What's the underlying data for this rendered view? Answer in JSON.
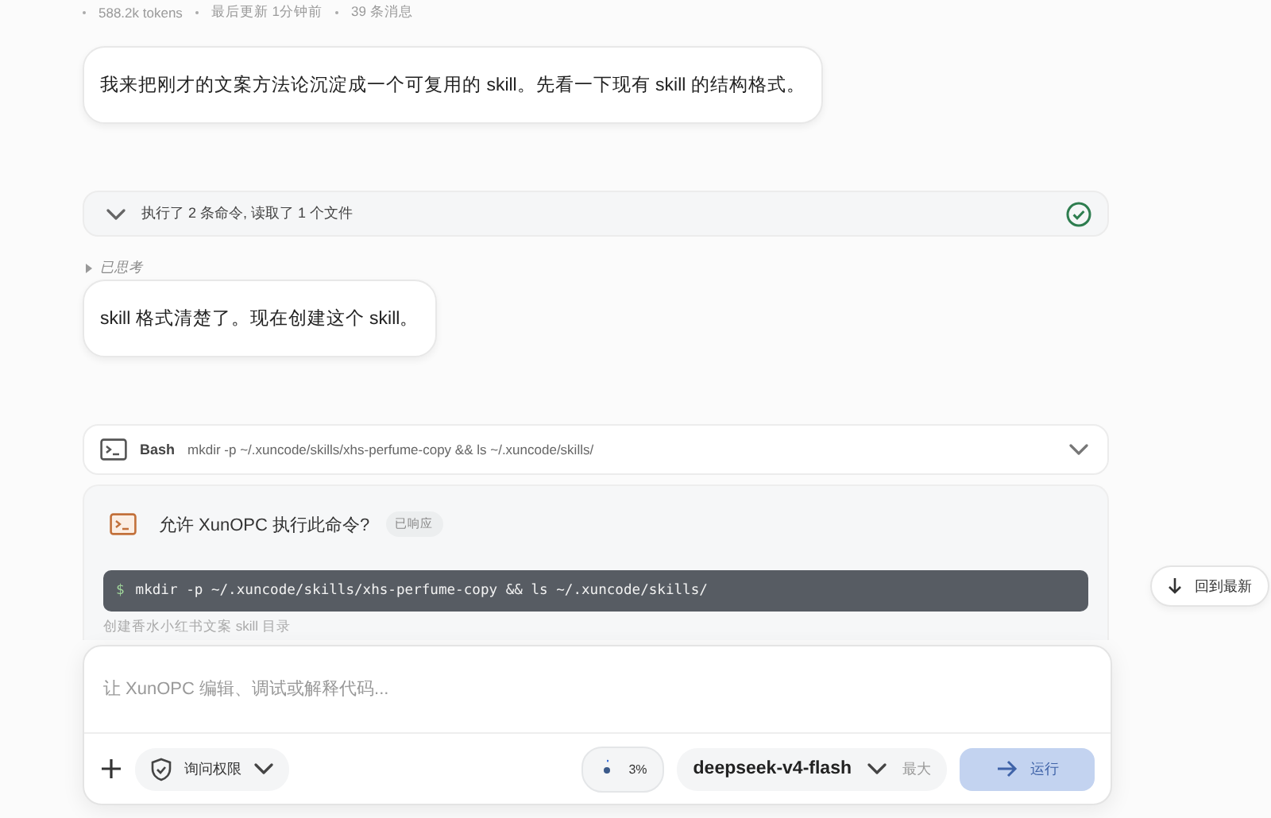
{
  "meta": {
    "tokens": "588.2k tokens",
    "updated": "最后更新 1分钟前",
    "messages": "39 条消息"
  },
  "messages": [
    {
      "kind": "bubble",
      "text": "我来把刚才的文案方法论沉淀成一个可复用的 skill。先看一下现有 skill 的结构格式。"
    },
    {
      "kind": "steps",
      "text": "执行了 2 条命令, 读取了 1 个文件",
      "expanded": false,
      "done": true
    },
    {
      "kind": "thinking",
      "text": "已思考"
    },
    {
      "kind": "bubble",
      "text": "skill 格式清楚了。现在创建这个 skill。"
    },
    {
      "kind": "tool",
      "tool": "Bash",
      "command": "mkdir -p ~/.xuncode/skills/xhs-perfume-copy && ls ~/.xuncode/skills/",
      "expanded": false
    },
    {
      "kind": "permission",
      "question": "允许 XunOPC 执行此命令?",
      "status": "已响应",
      "prompt": "$",
      "command": "mkdir -p ~/.xuncode/skills/xhs-perfume-copy && ls ~/.xuncode/skills/",
      "description": "创建香水小红书文案 skill 目录"
    }
  ],
  "jump_button": "回到最新",
  "composer": {
    "placeholder": "让 XunOPC 编辑、调试或解释代码...",
    "permission": "询问权限",
    "context": "3%",
    "model": "deepseek-v4-flash",
    "effort": "最大",
    "send": "运行",
    "send_disabled": true
  }
}
